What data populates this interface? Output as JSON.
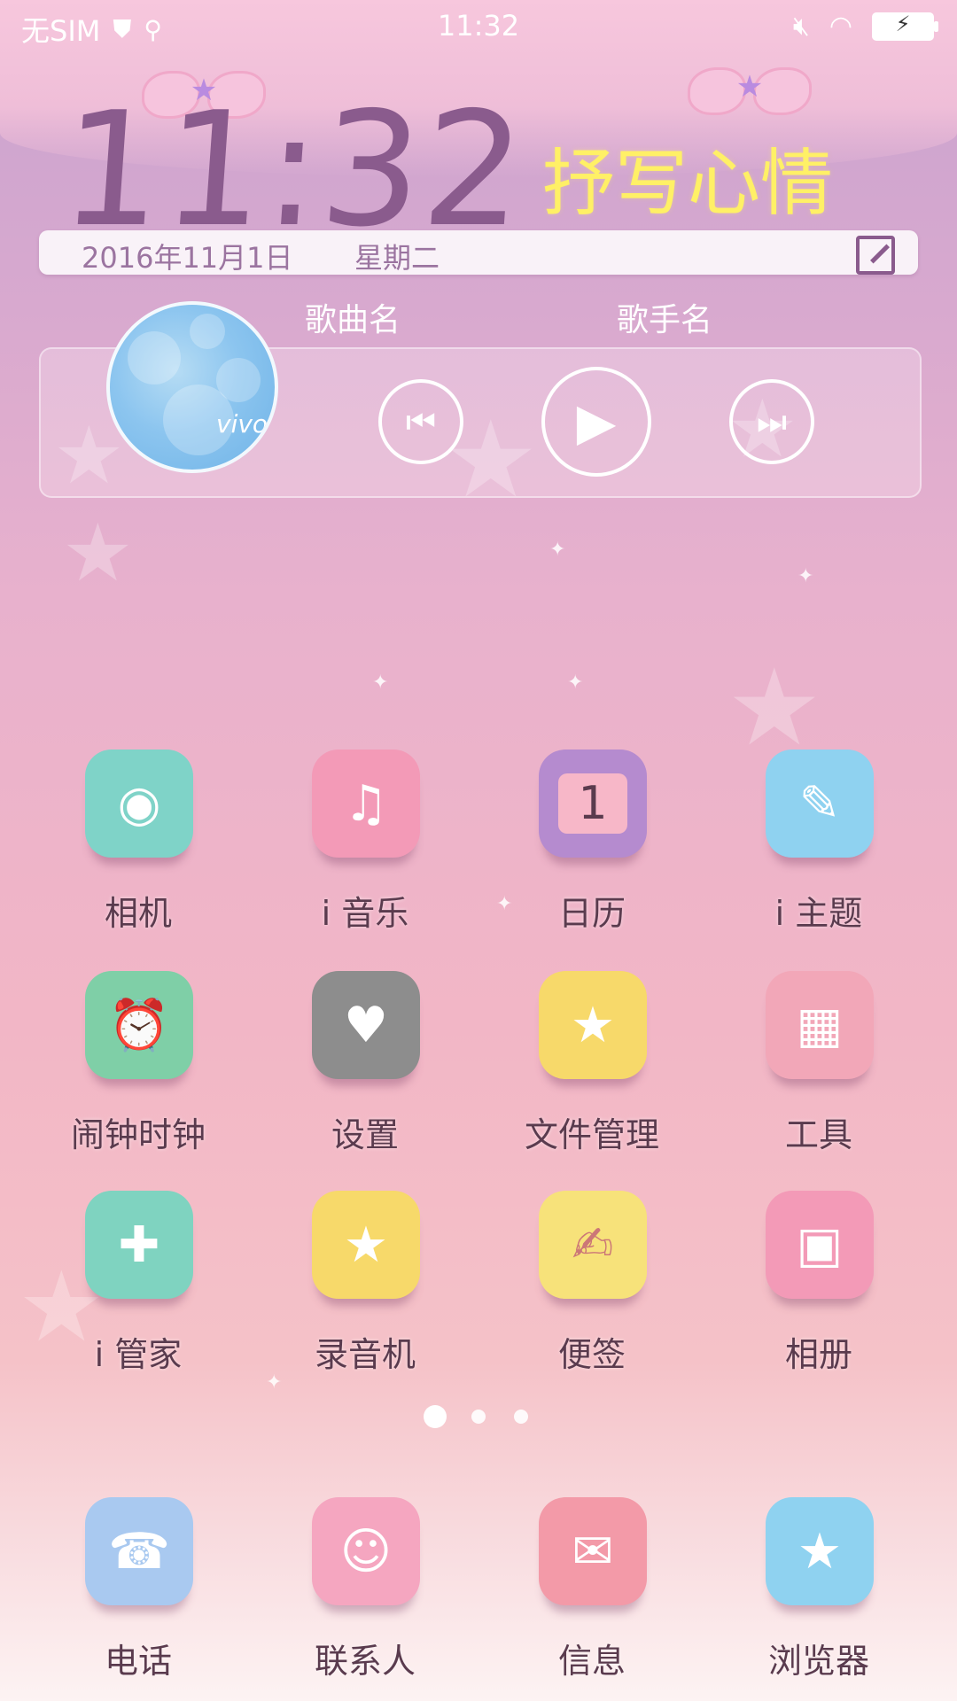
{
  "status_bar": {
    "sim": "无SIM",
    "time": "11:32",
    "battery_icon": "battery-charging-icon"
  },
  "widget": {
    "clock": "11:32",
    "mood_text": "抒写心情",
    "date": "2016年11月1日",
    "weekday": "星期二",
    "music": {
      "song": "歌曲名",
      "artist": "歌手名",
      "album_logo": "vivo"
    }
  },
  "apps": [
    {
      "label": "相机",
      "icon": "camera-icon",
      "color": "#7fd3c8"
    },
    {
      "label": "i 音乐",
      "icon": "harp-icon",
      "color": "#f39ab7"
    },
    {
      "label": "日历",
      "icon": "calendar-icon",
      "color": "#b58bcf",
      "calendar_day": "1"
    },
    {
      "label": "i 主题",
      "icon": "paintbrush-icon",
      "color": "#8fd2f0"
    },
    {
      "label": "闹钟时钟",
      "icon": "alarm-clock-icon",
      "color": "#7fcfa7"
    },
    {
      "label": "设置",
      "icon": "gear-icon",
      "color": "#8d8d8d"
    },
    {
      "label": "文件管理",
      "icon": "folder-icon",
      "color": "#f7d96a"
    },
    {
      "label": "工具",
      "icon": "toolbox-icon",
      "color": "#f2a7b8"
    },
    {
      "label": "i 管家",
      "icon": "heart-plus-icon",
      "color": "#7fd3c0"
    },
    {
      "label": "录音机",
      "icon": "recorder-icon",
      "color": "#f7d96a"
    },
    {
      "label": "便签",
      "icon": "note-icon",
      "color": "#f7e27a"
    },
    {
      "label": "相册",
      "icon": "photo-frame-icon",
      "color": "#f39ab7"
    }
  ],
  "dock": [
    {
      "label": "电话",
      "icon": "phone-icon",
      "color": "#a9c9f0"
    },
    {
      "label": "联系人",
      "icon": "contacts-icon",
      "color": "#f5a6c0"
    },
    {
      "label": "信息",
      "icon": "envelope-icon",
      "color": "#f39aa8"
    },
    {
      "label": "浏览器",
      "icon": "globe-icon",
      "color": "#8fd2f0"
    }
  ],
  "page_indicator": {
    "pages": 3,
    "current": 1
  }
}
